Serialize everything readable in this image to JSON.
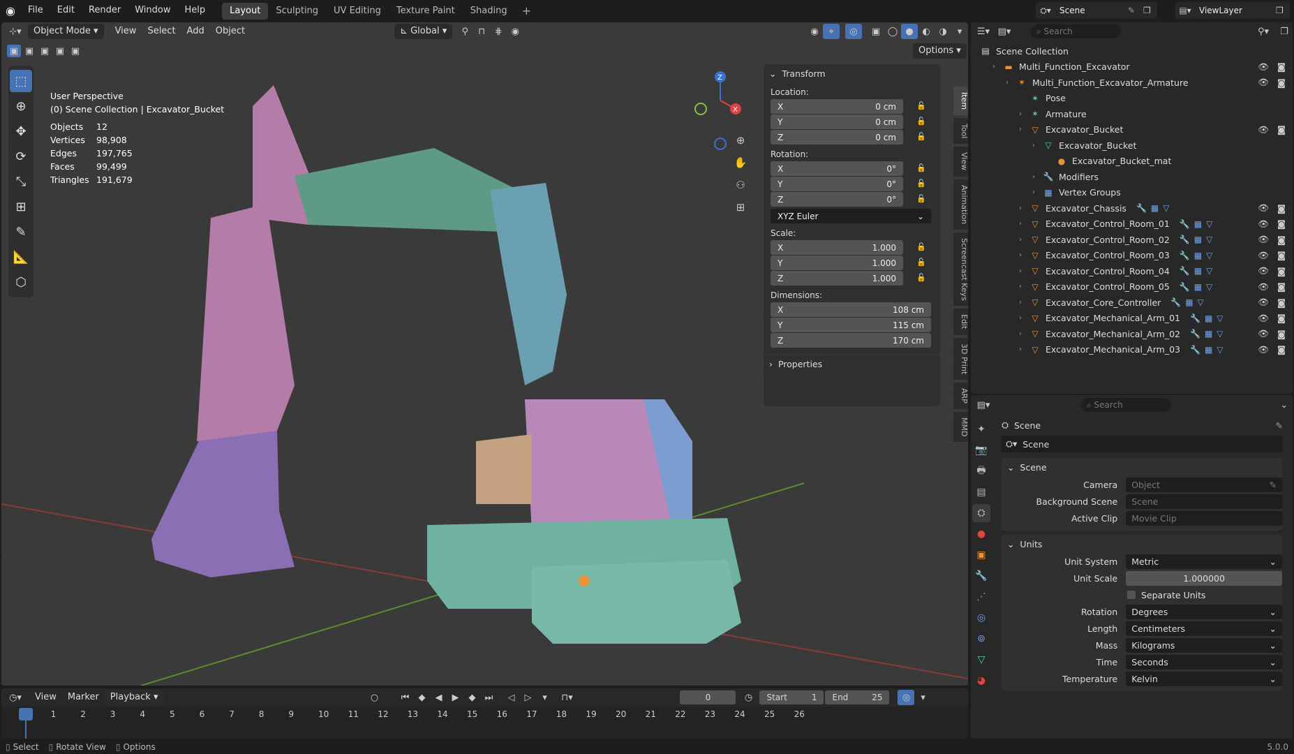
{
  "topbar": {
    "menus": [
      "File",
      "Edit",
      "Render",
      "Window",
      "Help"
    ],
    "workspaces": [
      "Layout",
      "Sculpting",
      "UV Editing",
      "Texture Paint",
      "Shading"
    ],
    "active_workspace": "Layout",
    "scene_name": "Scene",
    "view_layer": "ViewLayer"
  },
  "viewport_header": {
    "mode": "Object Mode",
    "menus": [
      "View",
      "Select",
      "Add",
      "Object"
    ],
    "orientation": "Global",
    "options_label": "Options"
  },
  "viewport_info": {
    "perspective": "User Perspective",
    "collection": "(0) Scene Collection | Excavator_Bucket",
    "stats": [
      {
        "label": "Objects",
        "value": "12"
      },
      {
        "label": "Vertices",
        "value": "98,908"
      },
      {
        "label": "Edges",
        "value": "197,765"
      },
      {
        "label": "Faces",
        "value": "99,499"
      },
      {
        "label": "Triangles",
        "value": "191,679"
      }
    ]
  },
  "gizmo": {
    "z": "Z",
    "x": "X"
  },
  "npanel": {
    "header": "Transform",
    "location_label": "Location:",
    "location": [
      {
        "axis": "X",
        "value": "0 cm"
      },
      {
        "axis": "Y",
        "value": "0 cm"
      },
      {
        "axis": "Z",
        "value": "0 cm"
      }
    ],
    "rotation_label": "Rotation:",
    "rotation": [
      {
        "axis": "X",
        "value": "0°"
      },
      {
        "axis": "Y",
        "value": "0°"
      },
      {
        "axis": "Z",
        "value": "0°"
      }
    ],
    "rotation_mode": "XYZ Euler",
    "scale_label": "Scale:",
    "scale": [
      {
        "axis": "X",
        "value": "1.000"
      },
      {
        "axis": "Y",
        "value": "1.000"
      },
      {
        "axis": "Z",
        "value": "1.000"
      }
    ],
    "dimensions_label": "Dimensions:",
    "dimensions": [
      {
        "axis": "X",
        "value": "108 cm"
      },
      {
        "axis": "Y",
        "value": "115 cm"
      },
      {
        "axis": "Z",
        "value": "170 cm"
      }
    ],
    "properties_label": "Properties",
    "tabs": [
      "Item",
      "Tool",
      "View",
      "Animation",
      "Screencast Keys",
      "Edit",
      "3D Print",
      "ARP",
      "MMD"
    ]
  },
  "outliner": {
    "search_placeholder": "Search",
    "root": "Scene Collection",
    "rows": [
      {
        "name": "Multi_Function_Excavator",
        "indent": 1,
        "icon": "▬",
        "icolor": "orange"
      },
      {
        "name": "Multi_Function_Excavator_Armature",
        "indent": 2,
        "icon": "✶",
        "icolor": "orange"
      },
      {
        "name": "Pose",
        "indent": 3,
        "icon": "✶",
        "icolor": "teal"
      },
      {
        "name": "Armature",
        "indent": 3,
        "icon": "✶",
        "icolor": "teal"
      },
      {
        "name": "Excavator_Bucket",
        "indent": 3,
        "icon": "▽",
        "icolor": "orange"
      },
      {
        "name": "Excavator_Bucket",
        "indent": 4,
        "icon": "▽",
        "icolor": "teal"
      },
      {
        "name": "Excavator_Bucket_mat",
        "indent": 5,
        "icon": "●",
        "icolor": "orange"
      },
      {
        "name": "Modifiers",
        "indent": 4,
        "icon": "🔧",
        "icolor": "blue"
      },
      {
        "name": "Vertex Groups",
        "indent": 4,
        "icon": "▦",
        "icolor": "blue"
      },
      {
        "name": "Excavator_Chassis",
        "indent": 3,
        "icon": "▽",
        "icolor": "orange"
      },
      {
        "name": "Excavator_Control_Room_01",
        "indent": 3,
        "icon": "▽",
        "icolor": "orange"
      },
      {
        "name": "Excavator_Control_Room_02",
        "indent": 3,
        "icon": "▽",
        "icolor": "orange"
      },
      {
        "name": "Excavator_Control_Room_03",
        "indent": 3,
        "icon": "▽",
        "icolor": "orange"
      },
      {
        "name": "Excavator_Control_Room_04",
        "indent": 3,
        "icon": "▽",
        "icolor": "orange"
      },
      {
        "name": "Excavator_Control_Room_05",
        "indent": 3,
        "icon": "▽",
        "icolor": "orange"
      },
      {
        "name": "Excavator_Core_Controller",
        "indent": 3,
        "icon": "▽",
        "icolor": "orange"
      },
      {
        "name": "Excavator_Mechanical_Arm_01",
        "indent": 3,
        "icon": "▽",
        "icolor": "orange"
      },
      {
        "name": "Excavator_Mechanical_Arm_02",
        "indent": 3,
        "icon": "▽",
        "icolor": "orange"
      },
      {
        "name": "Excavator_Mechanical_Arm_03",
        "indent": 3,
        "icon": "▽",
        "icolor": "orange"
      }
    ]
  },
  "properties": {
    "search_placeholder": "Search",
    "context": "Scene",
    "datablock": "Scene",
    "scene_section": "Scene",
    "camera_label": "Camera",
    "camera_value": "Object",
    "background_label": "Background Scene",
    "background_value": "Scene",
    "clip_label": "Active Clip",
    "clip_value": "Movie Clip",
    "units_section": "Units",
    "unit_system_label": "Unit System",
    "unit_system": "Metric",
    "unit_scale_label": "Unit Scale",
    "unit_scale": "1.000000",
    "separate_units": "Separate Units",
    "rotation_label": "Rotation",
    "rotation": "Degrees",
    "length_label": "Length",
    "length": "Centimeters",
    "mass_label": "Mass",
    "mass": "Kilograms",
    "time_label": "Time",
    "time": "Seconds",
    "temperature_label": "Temperature",
    "temperature": "Kelvin"
  },
  "timeline": {
    "menus": [
      "View",
      "Marker",
      "Playback"
    ],
    "current_frame": "0",
    "start_label": "Start",
    "start": "1",
    "end_label": "End",
    "end": "25",
    "frames": [
      "0",
      "1",
      "2",
      "3",
      "4",
      "5",
      "6",
      "7",
      "8",
      "9",
      "10",
      "11",
      "12",
      "13",
      "14",
      "15",
      "16",
      "17",
      "18",
      "19",
      "20",
      "21",
      "22",
      "23",
      "24",
      "25",
      "26"
    ]
  },
  "status": {
    "select": "Select",
    "rotate": "Rotate View",
    "options": "Options",
    "version": "5.0.0"
  }
}
